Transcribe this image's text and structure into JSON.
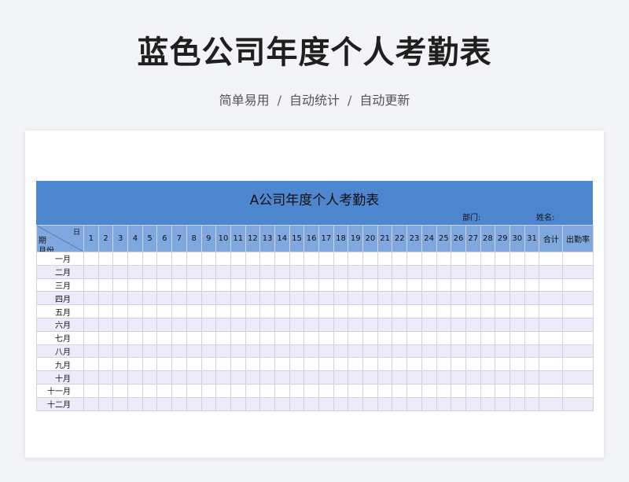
{
  "page": {
    "title": "蓝色公司年度个人考勤表",
    "subtitle_parts": [
      "简单易用",
      "自动统计",
      "自动更新"
    ],
    "subtitle_separator": "/"
  },
  "sheet": {
    "title": "A公司年度个人考勤表",
    "dept_label": "部门:",
    "name_label": "姓名:",
    "corner": {
      "day": "日",
      "period": "期",
      "month": "月份"
    },
    "days": [
      "1",
      "2",
      "3",
      "4",
      "5",
      "6",
      "7",
      "8",
      "9",
      "10",
      "11",
      "12",
      "13",
      "14",
      "15",
      "16",
      "17",
      "18",
      "19",
      "20",
      "21",
      "22",
      "23",
      "24",
      "25",
      "26",
      "27",
      "28",
      "29",
      "30",
      "31"
    ],
    "total_label": "合计",
    "attendance_rate_label": "出勤率",
    "months": [
      "一月",
      "二月",
      "三月",
      "四月",
      "五月",
      "六月",
      "七月",
      "八月",
      "九月",
      "十月",
      "十一月",
      "十二月"
    ]
  },
  "colors": {
    "header_band": "#4e86cf",
    "column_header": "#7fa8e0",
    "row_stripe": "#eeeafa",
    "page_background": "#f3f4f8"
  }
}
